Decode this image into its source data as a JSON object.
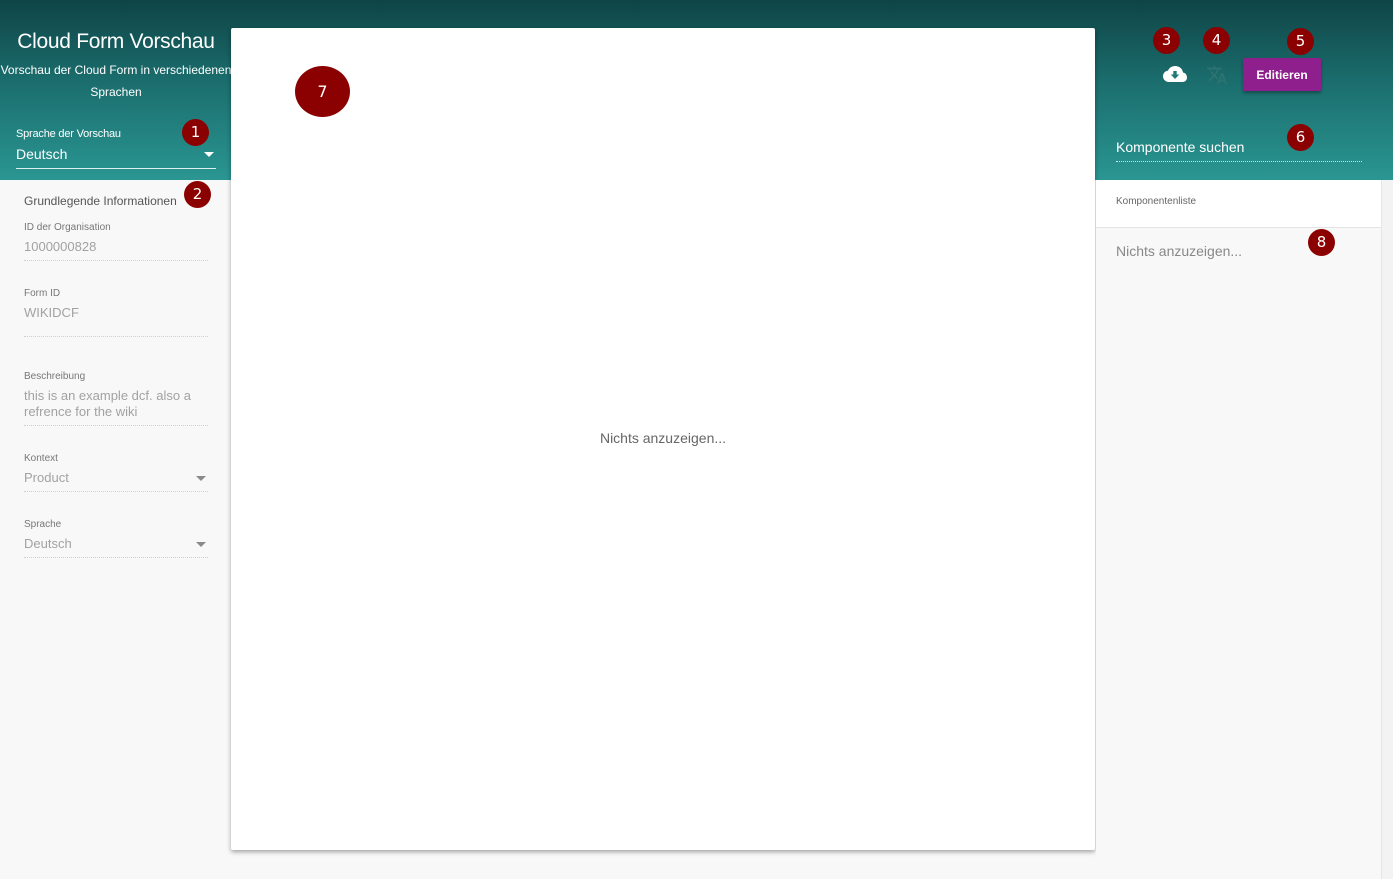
{
  "header": {
    "title": "Cloud Form Vorschau",
    "subtitle": "Vorschau der Cloud Form in verschiedenen Sprachen",
    "preview_language_label": "Sprache der Vorschau",
    "preview_language_value": "Deutsch",
    "edit_button_label": "Editieren",
    "icons": [
      "cloud-download-icon",
      "translate-icon"
    ]
  },
  "sidebar": {
    "section_title": "Grundlegende Informationen",
    "fields": [
      {
        "label": "ID der Organisation",
        "value": "1000000828"
      },
      {
        "label": "Form ID",
        "value": "WIKIDCF"
      },
      {
        "label": "Beschreibung",
        "value": "this is an example dcf. also a refrence for the wiki"
      },
      {
        "label": "Kontext",
        "value": "Product"
      },
      {
        "label": "Sprache",
        "value": "Deutsch"
      }
    ]
  },
  "preview": {
    "empty_text": "Nichts anzuzeigen..."
  },
  "components": {
    "search_placeholder": "Komponente suchen",
    "list_header": "Komponentenliste",
    "empty_text": "Nichts anzuzeigen..."
  },
  "markers": [
    "1",
    "2",
    "3",
    "4",
    "5",
    "6",
    "7",
    "8"
  ],
  "colors": {
    "header_top": "#0f4446",
    "header_bottom": "#2a9692",
    "edit_button": "#8e1f8c",
    "marker": "#8b0000"
  }
}
